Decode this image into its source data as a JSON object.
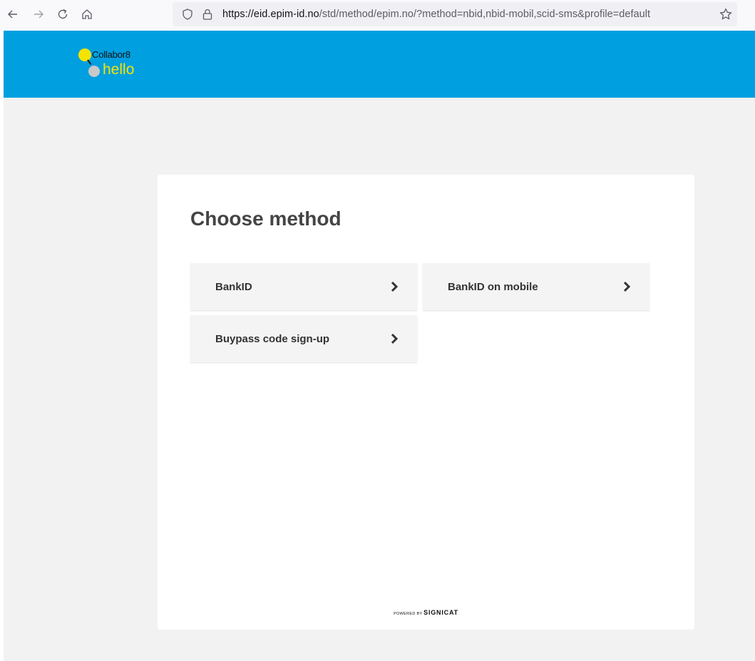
{
  "browser": {
    "url_host": "https://eid.epim-id.no",
    "url_rest": "/std/method/epim.no/?method=nbid,nbid-mobil,scid-sms&profile=default",
    "icons": [
      "back-icon",
      "forward-icon",
      "reload-icon",
      "home-icon",
      "shield-icon",
      "lock-icon",
      "star-icon"
    ]
  },
  "logo": {
    "top_text": "Collabor8",
    "bottom_text": "hello"
  },
  "card": {
    "title": "Choose method",
    "methods": [
      {
        "label": "BankID"
      },
      {
        "label": "BankID on mobile"
      },
      {
        "label": "Buypass code sign-up"
      }
    ],
    "footer_prefix": "POWERED BY",
    "footer_brand": "SIGNICAT"
  },
  "colors": {
    "header": "#009fdf",
    "logo_yellow": "#f6e400",
    "page_background": "#f2f2f2",
    "card": "#ffffff",
    "method_background": "#f4f4f4"
  }
}
